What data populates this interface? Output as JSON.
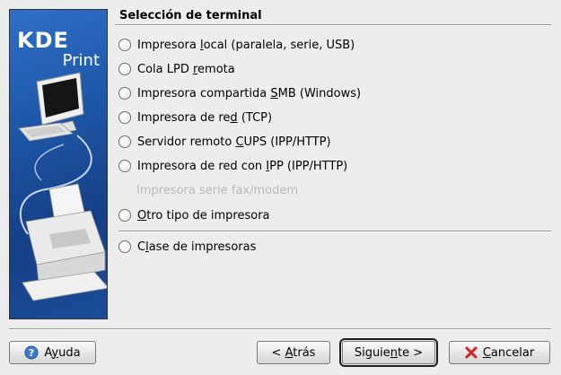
{
  "banner": {
    "logo_top": "KDE",
    "logo_bottom": "Print"
  },
  "section": {
    "title": "Selección de terminal"
  },
  "options": [
    {
      "pre": "Impresora ",
      "u": "l",
      "post": "ocal (paralela, serie, USB)",
      "enabled": true
    },
    {
      "pre": "Cola LPD ",
      "u": "r",
      "post": "emota",
      "enabled": true
    },
    {
      "pre": "Impresora compartida ",
      "u": "S",
      "post": "MB (Windows)",
      "enabled": true
    },
    {
      "pre": "Impresora de re",
      "u": "d",
      "post": " (TCP)",
      "enabled": true
    },
    {
      "pre": "Servidor remoto ",
      "u": "C",
      "post": "UPS (IPP/HTTP)",
      "enabled": true
    },
    {
      "pre": "Impresora de red con ",
      "u": "I",
      "post": "PP (IPP/HTTP)",
      "enabled": true
    },
    {
      "pre": "Impresora serie fax/modem",
      "u": "",
      "post": "",
      "enabled": false
    },
    {
      "pre": "",
      "u": "O",
      "post": "tro tipo de impresora",
      "enabled": true
    },
    {
      "pre": "C",
      "u": "l",
      "post": "ase de impresoras",
      "enabled": true
    }
  ],
  "buttons": {
    "help": {
      "pre": "A",
      "u": "y",
      "post": "uda"
    },
    "back": {
      "pre": "< ",
      "u": "A",
      "post": "trás"
    },
    "next": {
      "pre": "Siguie",
      "u": "n",
      "post": "te >"
    },
    "cancel": {
      "pre": "",
      "u": "C",
      "post": "ancelar"
    }
  },
  "colors": {
    "banner": "#1d57a8",
    "disabled_text": "#b8b8b8",
    "cancel_icon": "#d42020",
    "help_icon": "#3a7bd5"
  },
  "icons": {
    "help": "help-icon",
    "cancel": "cancel-x-icon"
  }
}
